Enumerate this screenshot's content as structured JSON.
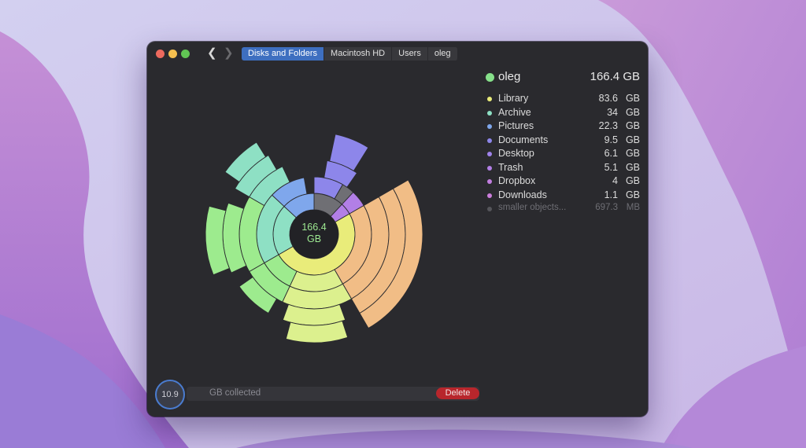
{
  "breadcrumbs": [
    "Disks and Folders",
    "Macintosh HD",
    "Users",
    "oleg"
  ],
  "legend": {
    "folder": "oleg",
    "folder_size": "166.4 GB",
    "folder_color": "#86e08a",
    "items": [
      {
        "name": "Library",
        "num": "83.6",
        "unit": "GB",
        "color": "#e9ec7a"
      },
      {
        "name": "Archive",
        "num": "34",
        "unit": "GB",
        "color": "#8ee0c4"
      },
      {
        "name": "Pictures",
        "num": "22.3",
        "unit": "GB",
        "color": "#7fa7ec"
      },
      {
        "name": "Documents",
        "num": "9.5",
        "unit": "GB",
        "color": "#8d86ea"
      },
      {
        "name": "Desktop",
        "num": "6.1",
        "unit": "GB",
        "color": "#a083ec"
      },
      {
        "name": "Trash",
        "num": "5.1",
        "unit": "GB",
        "color": "#b27fe6"
      },
      {
        "name": "Dropbox",
        "num": "4",
        "unit": "GB",
        "color": "#c27ee0"
      },
      {
        "name": "Downloads",
        "num": "1.1",
        "unit": "GB",
        "color": "#cc7edc"
      },
      {
        "name": "smaller objects...",
        "num": "697.3",
        "unit": "MB",
        "color": "#55555a",
        "dim": true
      }
    ]
  },
  "center": {
    "value": "166.4",
    "unit": "GB"
  },
  "collector": {
    "value": "10.9",
    "label": "GB collected",
    "delete_label": "Delete"
  },
  "colors": {
    "library": "#e9ec7a",
    "library_orange": "#f1bd86",
    "library_lime": "#dcf08e",
    "archive": "#8ee0c4",
    "archive_green": "#9deb8e",
    "pictures": "#7fa7ec",
    "documents": "#8d86ea",
    "trash": "#b27fe6",
    "gray": "#6f6f74"
  }
}
